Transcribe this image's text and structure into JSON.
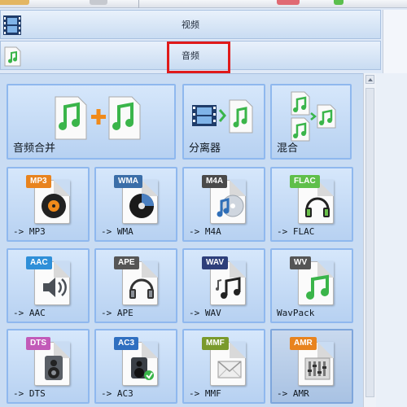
{
  "header": {
    "video_label": "视频",
    "audio_label": "音频"
  },
  "tiles": [
    {
      "label": "音频合并",
      "icon": "audio-join-icon"
    },
    {
      "label": "分离器",
      "icon": "splitter-icon"
    },
    {
      "label": "混合",
      "icon": "mix-icon"
    },
    {
      "label": "-> MP3",
      "tag": "MP3",
      "tag_color": "#e8831e",
      "icon": "vinyl-icon"
    },
    {
      "label": "-> WMA",
      "tag": "WMA",
      "tag_color": "#3b6ea8",
      "icon": "media-disc-icon"
    },
    {
      "label": "-> M4A",
      "tag": "M4A",
      "tag_color": "#4a4a4a",
      "icon": "music-disc-icon"
    },
    {
      "label": "-> FLAC",
      "tag": "FLAC",
      "tag_color": "#5fbf4a",
      "icon": "headphones-icon"
    },
    {
      "label": "-> AAC",
      "tag": "AAC",
      "tag_color": "#2f8fd8",
      "icon": "speaker-icon"
    },
    {
      "label": "-> APE",
      "tag": "APE",
      "tag_color": "#555555",
      "icon": "headphones-icon"
    },
    {
      "label": "-> WAV",
      "tag": "WAV",
      "tag_color": "#2e3f7a",
      "icon": "music-notes-icon"
    },
    {
      "label": "WavPack",
      "tag": "WV",
      "tag_color": "#555555",
      "icon": "green-note-icon"
    },
    {
      "label": "-> DTS",
      "tag": "DTS",
      "tag_color": "#c25ab8",
      "icon": "speaker-icon"
    },
    {
      "label": "-> AC3",
      "tag": "AC3",
      "tag_color": "#2f6fc0",
      "icon": "speaker-icon"
    },
    {
      "label": "-> MMF",
      "tag": "MMF",
      "tag_color": "#7a9a2c",
      "icon": "envelope-icon"
    },
    {
      "label": "-> AMR",
      "tag": "AMR",
      "tag_color": "#e8831e",
      "icon": "equalizer-icon"
    }
  ]
}
